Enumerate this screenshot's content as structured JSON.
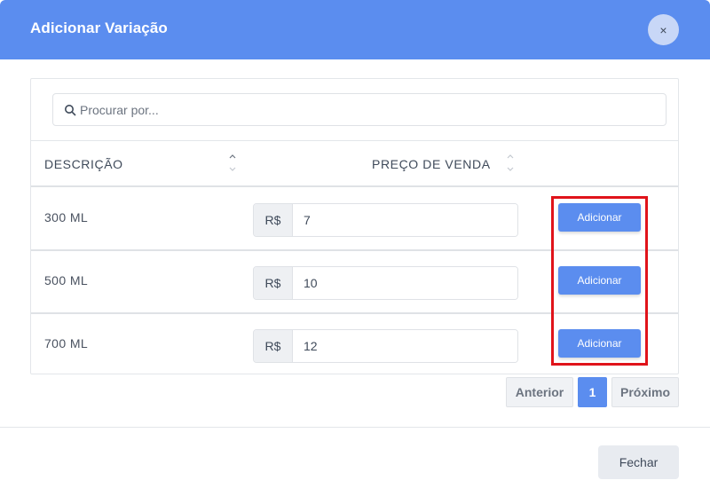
{
  "modal": {
    "title": "Adicionar Variação",
    "close_label": "×"
  },
  "search": {
    "placeholder": "Procurar por..."
  },
  "table": {
    "columns": [
      "DESCRIÇÃO",
      "PREÇO DE VENDA"
    ],
    "rows": [
      {
        "description": "300 ML",
        "currency": "R$",
        "price": "7",
        "action": "Adicionar"
      },
      {
        "description": "500 ML",
        "currency": "R$",
        "price": "10",
        "action": "Adicionar"
      },
      {
        "description": "700 ML",
        "currency": "R$",
        "price": "12",
        "action": "Adicionar"
      }
    ]
  },
  "pagination": {
    "prev": "Anterior",
    "current": "1",
    "next": "Próximo"
  },
  "footer": {
    "close": "Fechar"
  },
  "colors": {
    "primary": "#5b8def",
    "highlight": "#e0131a"
  }
}
